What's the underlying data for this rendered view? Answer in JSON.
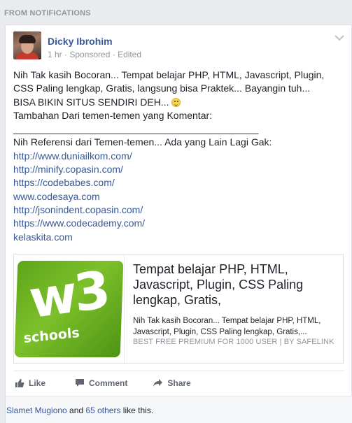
{
  "section": {
    "header": "FROM NOTIFICATIONS"
  },
  "post": {
    "author": "Dicky Ibrohim",
    "time": "1 hr",
    "sponsored": "Sponsored",
    "edited": "Edited",
    "separator": " · ",
    "text_lines": [
      "Nih Tak kasih Bocoran... Tempat belajar PHP, HTML, Javascript, Plugin,",
      "CSS Paling lengkap, Gratis, langsung bisa Praktek... Bayangin tuh...",
      "BISA BIKIN SITUS SENDIRI DEH...",
      "Tambahan Dari temen-temen yang Komentar:",
      "_____________________________________________",
      "Nih Referensi dari Temen-temen... Ada yang Lain Lagi Gak:"
    ],
    "links": [
      "http://www.duniailkom.com/",
      "http://minify.copasin.com/",
      "https://codebabes.com/",
      "www.codesaya.com",
      "http://jsonindent.copasin.com/",
      "https://www.codecademy.com/",
      "kelaskita.com"
    ]
  },
  "preview": {
    "image_w3": "w3",
    "image_schools": "schools",
    "title": "Tempat belajar PHP, HTML, Javascript, Plugin, CSS Paling lengkap, Gratis,",
    "description": "Nih Tak kasih Bocoran... Tempat belajar PHP, HTML, Javascript, Plugin, CSS Paling lengkap, Gratis,...",
    "source": "BEST FREE PREMIUM FOR 1000 USER | BY SAFELINK"
  },
  "actions": {
    "like": "Like",
    "comment": "Comment",
    "share": "Share"
  },
  "likes": {
    "name": "Slamet Mugiono",
    "and": " and ",
    "others": "65 others",
    "suffix": " like this."
  },
  "colors": {
    "link": "#365899",
    "background": "#e9ebee",
    "w3_green": "#6ab221"
  }
}
